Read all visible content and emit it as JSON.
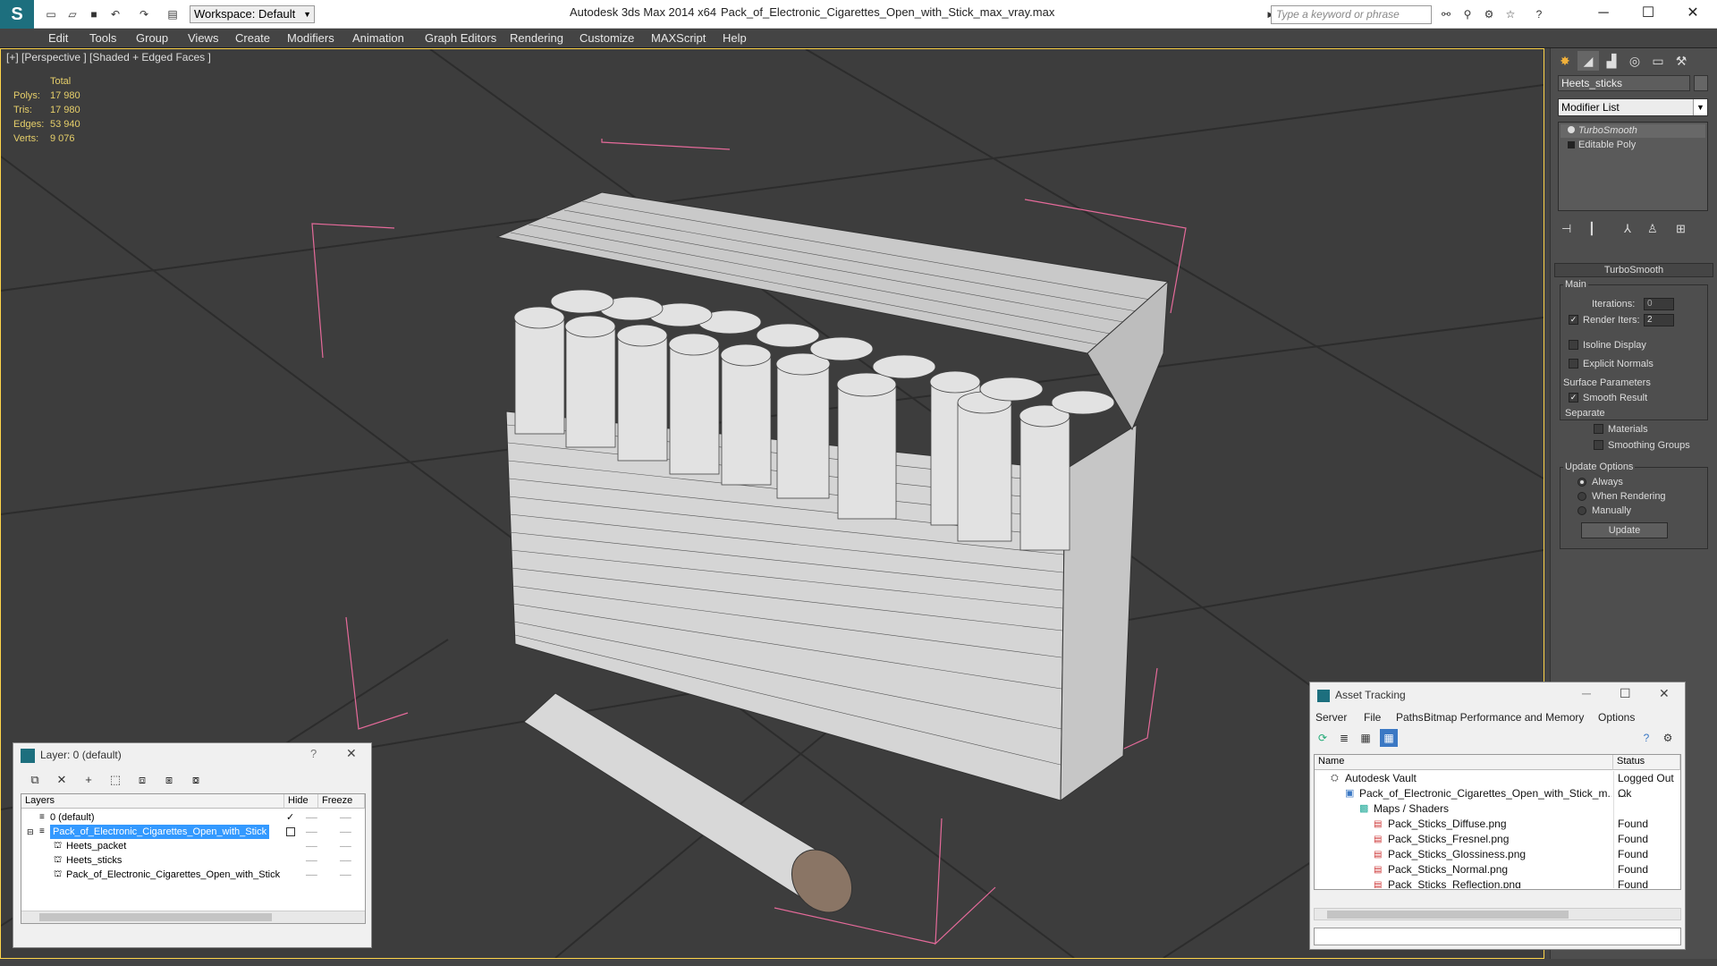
{
  "titlebar": {
    "app_title": "Autodesk 3ds Max  2014 x64",
    "file_title": "Pack_of_Electronic_Cigarettes_Open_with_Stick_max_vray.max",
    "workspace_label": "Workspace: Default",
    "search_placeholder": "Type a keyword or phrase"
  },
  "menu": [
    "Edit",
    "Tools",
    "Group",
    "Views",
    "Create",
    "Modifiers",
    "Animation",
    "Graph Editors",
    "Rendering",
    "Customize",
    "MAXScript",
    "Help"
  ],
  "viewport": {
    "label": "[+] [Perspective ] [Shaded + Edged Faces ]",
    "stats": {
      "header": "Total",
      "rows": [
        {
          "label": "Polys:",
          "value": "17 980"
        },
        {
          "label": "Tris:",
          "value": "17 980"
        },
        {
          "label": "Edges:",
          "value": "53 940"
        },
        {
          "label": "Verts:",
          "value": "9 076"
        }
      ]
    }
  },
  "command_panel": {
    "object_name": "Heets_sticks",
    "modifier_list": "Modifier List",
    "stack": [
      "TurboSmooth",
      "Editable Poly"
    ],
    "rollout_title": "TurboSmooth",
    "main_label": "Main",
    "iterations_label": "Iterations:",
    "iterations_value": "0",
    "render_iters_label": "Render Iters:",
    "render_iters_value": "2",
    "isoline_label": "Isoline Display",
    "explicit_label": "Explicit Normals",
    "surface_label": "Surface Parameters",
    "smooth_label": "Smooth Result",
    "separate_label": "Separate",
    "materials_label": "Materials",
    "smoothing_label": "Smoothing Groups",
    "update_options_label": "Update Options",
    "always_label": "Always",
    "when_rendering_label": "When Rendering",
    "manually_label": "Manually",
    "update_button": "Update"
  },
  "layer_dialog": {
    "title": "Layer: 0 (default)",
    "help": "?",
    "close": "✕",
    "col_layers": "Layers",
    "col_hide": "Hide",
    "col_freeze": "Freeze",
    "rows": [
      {
        "name": "0 (default)",
        "indent": 0
      },
      {
        "name": "Pack_of_Electronic_Cigarettes_Open_with_Stick",
        "indent": 0
      },
      {
        "name": "Heets_packet",
        "indent": 1
      },
      {
        "name": "Heets_sticks",
        "indent": 1
      },
      {
        "name": "Pack_of_Electronic_Cigarettes_Open_with_Stick",
        "indent": 1
      }
    ]
  },
  "asset_tracking": {
    "title": "Asset Tracking",
    "menu": [
      "Server",
      "File",
      "Paths",
      "Bitmap Performance and Memory",
      "Options"
    ],
    "col_name": "Name",
    "col_status": "Status",
    "rows": [
      {
        "name": "Autodesk Vault",
        "status": "Logged Out ..."
      },
      {
        "name": "Pack_of_Electronic_Cigarettes_Open_with_Stick_m...",
        "status": "Ok"
      },
      {
        "name": "Maps / Shaders",
        "status": ""
      },
      {
        "name": "Pack_Sticks_Diffuse.png",
        "status": "Found"
      },
      {
        "name": "Pack_Sticks_Fresnel.png",
        "status": "Found"
      },
      {
        "name": "Pack_Sticks_Glossiness.png",
        "status": "Found"
      },
      {
        "name": "Pack_Sticks_Normal.png",
        "status": "Found"
      },
      {
        "name": "Pack_Sticks_Reflection.png",
        "status": "Found"
      }
    ]
  },
  "colors": {
    "viewport_border": "#ffd54a",
    "stats_text": "#e6cf6a",
    "selection": "#3399ff"
  }
}
